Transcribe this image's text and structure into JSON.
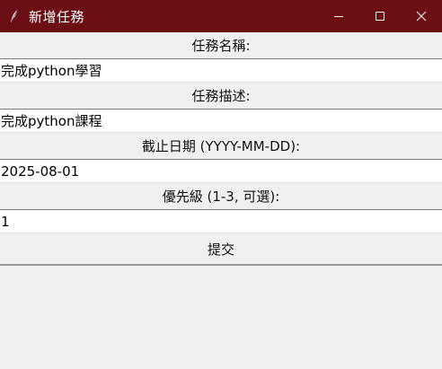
{
  "window": {
    "title": "新增任務",
    "icon": "feather-icon",
    "controls": [
      "minimize-icon",
      "maximize-icon",
      "close-icon"
    ]
  },
  "colors": {
    "titlebar": "#6b0f14",
    "background": "#f0f0f0",
    "entry_background": "#ffffff"
  },
  "form": {
    "name_label": "任務名稱:",
    "name_value": "完成python學習",
    "desc_label": "任務描述:",
    "desc_value": "完成python課程",
    "due_label": "截止日期 (YYYY-MM-DD):",
    "due_value": "2025-08-01",
    "priority_label": "優先級 (1-3, 可選):",
    "priority_value": "1",
    "submit_label": "提交"
  }
}
